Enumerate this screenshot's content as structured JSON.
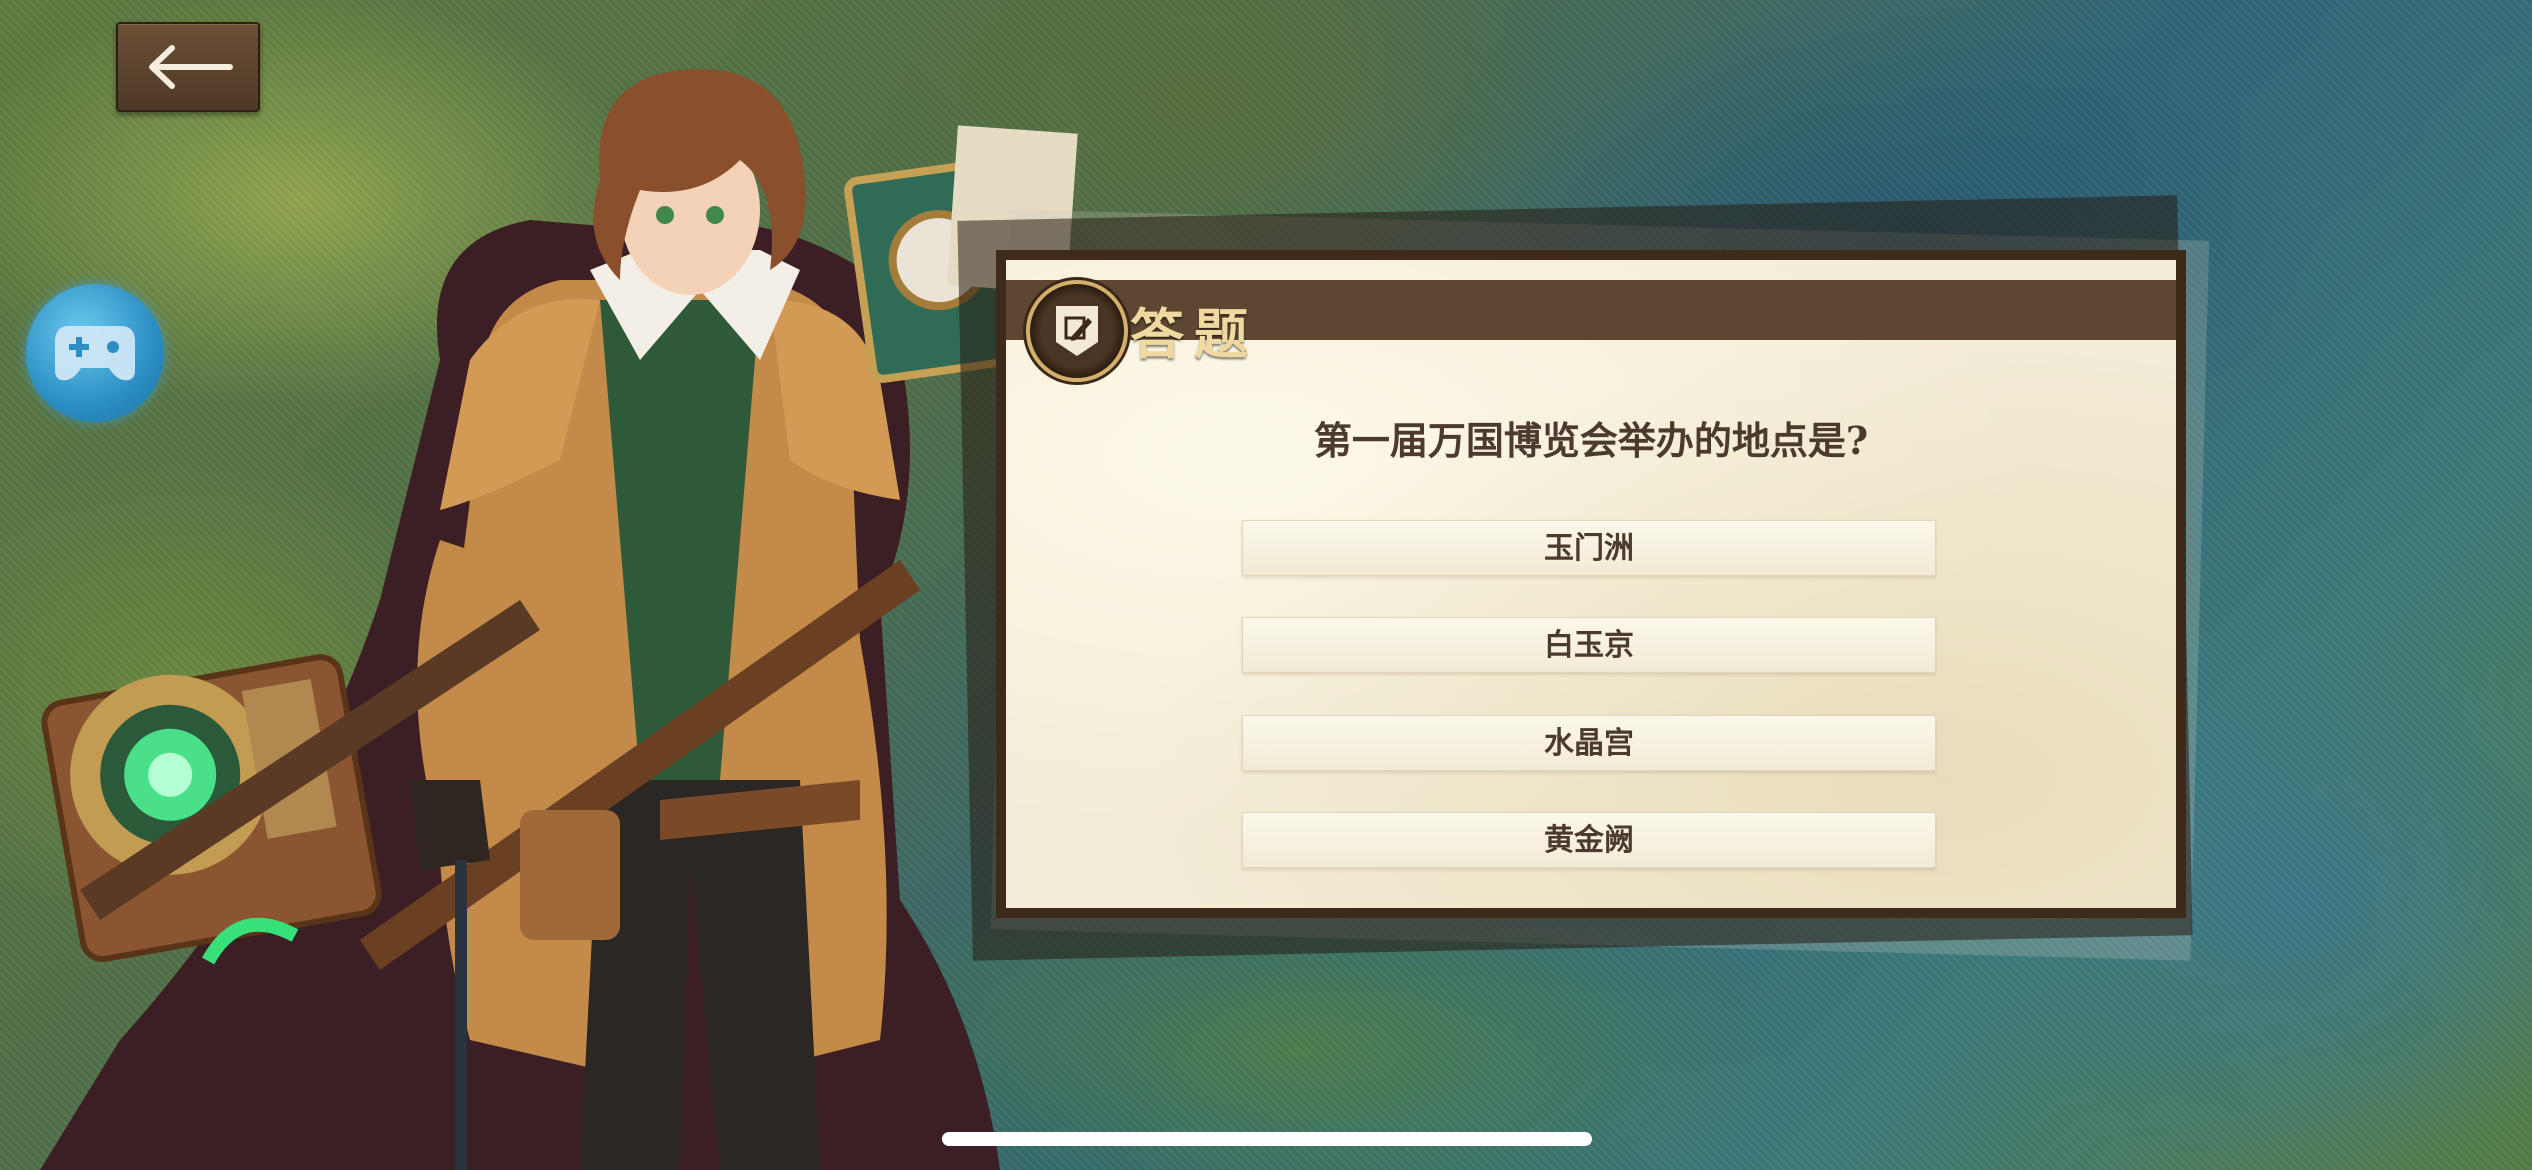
{
  "header": {
    "title": "答题"
  },
  "quiz": {
    "question": "第一届万国博览会举办的地点是?",
    "options": [
      {
        "label": "玉门洲"
      },
      {
        "label": "白玉京"
      },
      {
        "label": "水晶宫"
      },
      {
        "label": "黄金阙"
      }
    ]
  },
  "icons": {
    "back": "back-arrow-icon",
    "gamepad": "gamepad-icon",
    "quiz": "pencil-edit-icon"
  },
  "colors": {
    "panel_border": "#3e2a1a",
    "header_band": "#5d4733",
    "title_gold": "#f0d9a0",
    "parchment": "#f3ecd6",
    "text_brown": "#4c3a2c",
    "gamepad_blue": "#2b8fc4"
  }
}
